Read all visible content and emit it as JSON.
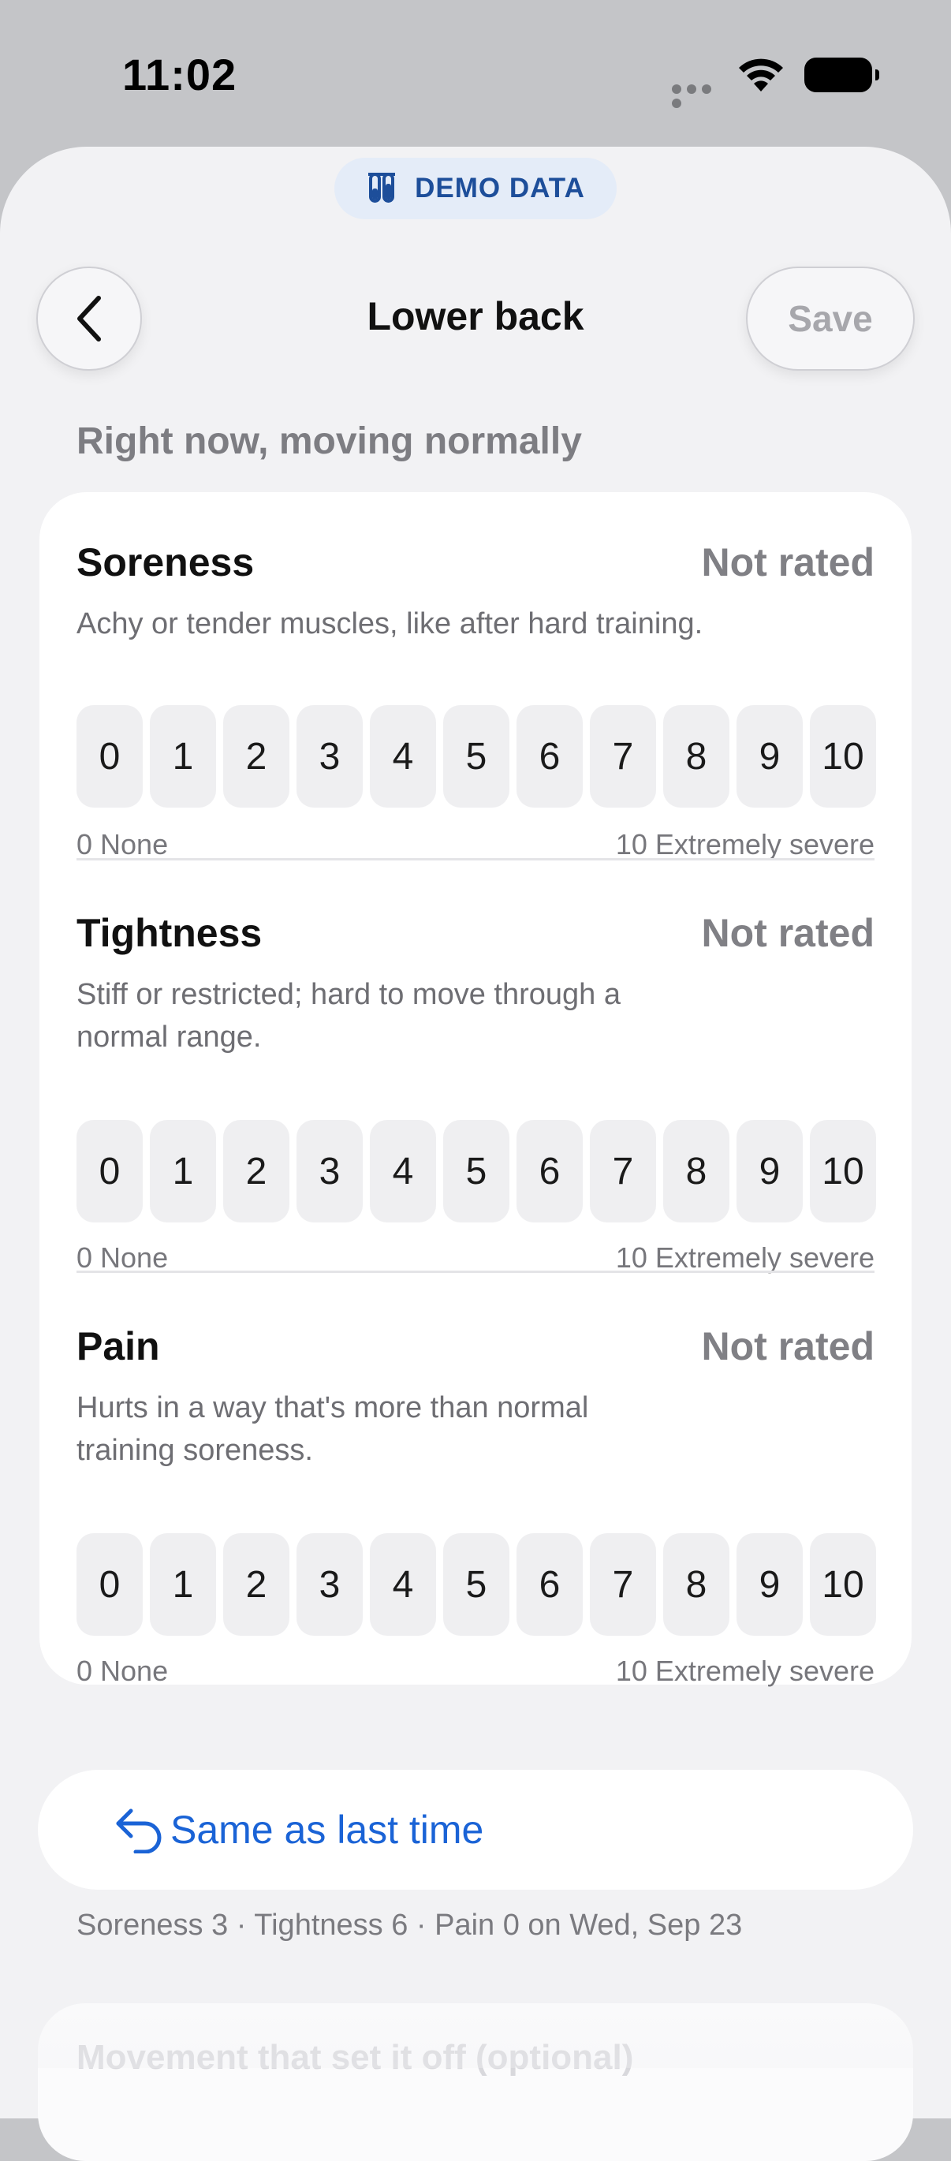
{
  "status_bar": {
    "time": "11:02"
  },
  "badge": {
    "label": "DEMO DATA",
    "icon": "test-tubes-icon",
    "color": "#1d4e9a"
  },
  "nav": {
    "title": "Lower back",
    "save_label": "Save",
    "back_icon": "chevron-left-icon"
  },
  "section_title": "Right now, moving normally",
  "scale_values": [
    "0",
    "1",
    "2",
    "3",
    "4",
    "5",
    "6",
    "7",
    "8",
    "9",
    "10"
  ],
  "items": [
    {
      "name": "Soreness",
      "status": "Not rated",
      "description": "Achy or tender muscles, like after hard training.",
      "min_label": "0 None",
      "max_label": "10 Extremely severe"
    },
    {
      "name": "Tightness",
      "status": "Not rated",
      "description": "Stiff or restricted; hard to move through a normal range.",
      "min_label": "0 None",
      "max_label": "10 Extremely severe"
    },
    {
      "name": "Pain",
      "status": "Not rated",
      "description": "Hurts in a way that's more than normal training soreness.",
      "min_label": "0 None",
      "max_label": "10 Extremely severe"
    }
  ],
  "same_as_last": {
    "label": "Same as last time",
    "icon": "undo-arrow-icon",
    "color": "#1a63d6",
    "summary": "Soreness 3 · Tightness 6 · Pain 0 on Wed, Sep 23"
  },
  "next_section": {
    "title": "Movement that set it off (optional)"
  }
}
